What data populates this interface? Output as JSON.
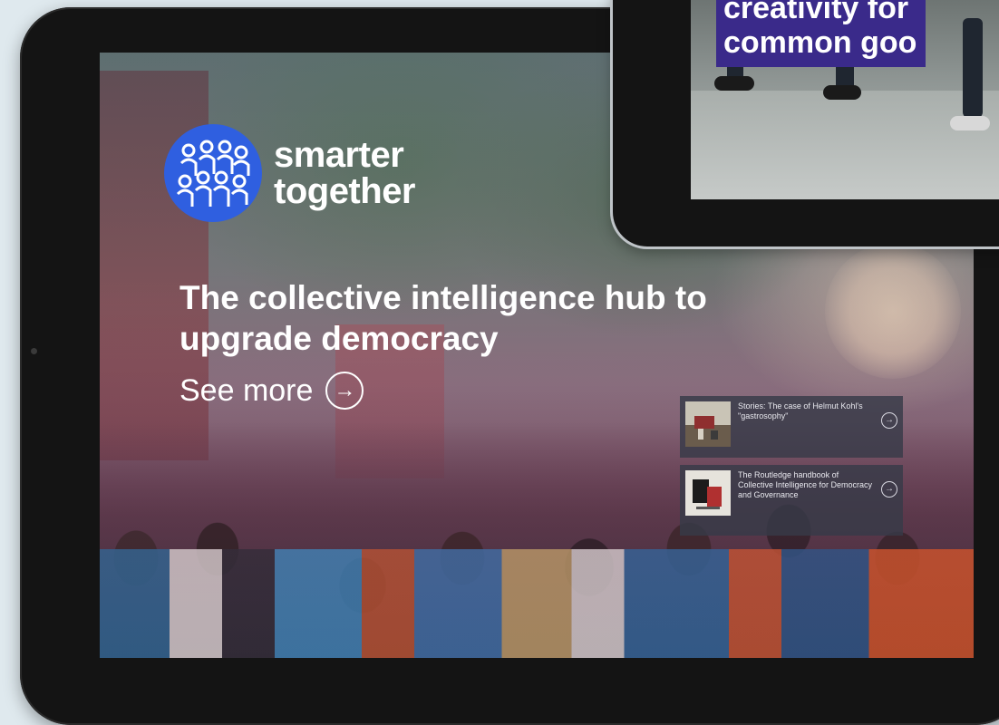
{
  "logo": {
    "line1": "smarter",
    "line2": "together",
    "brand_color": "#2f5fe0"
  },
  "hero": {
    "headline": "The collective intelligence hub to upgrade democracy",
    "see_more": "See more",
    "arrow_icon": "arrow-right-circle-icon"
  },
  "cards": [
    {
      "text": "Stories: The case of Helmut Kohl's \"gastrosophy\"",
      "thumb_icon": "photo-thumbnail-icon"
    },
    {
      "text": "The Routledge handbook of Collective Intelligence for Democracy and Governance",
      "thumb_icon": "book-cover-icon"
    }
  ],
  "phone": {
    "headline_line1": "creativity for",
    "headline_line2": "common goo",
    "headline_bg": "#3a2a8a"
  }
}
